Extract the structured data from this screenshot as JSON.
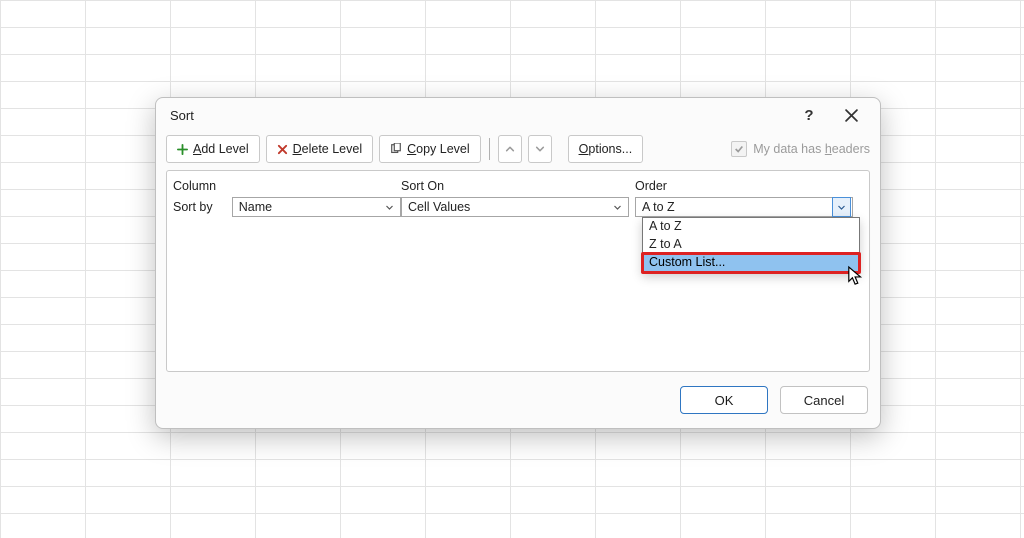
{
  "dialog": {
    "title": "Sort",
    "help_tooltip": "?",
    "toolbar": {
      "add_level": "Add Level",
      "delete_level": "Delete Level",
      "copy_level": "Copy Level",
      "options": "Options...",
      "headers_checkbox_label_prefix": "My data has ",
      "headers_checkbox_label_underlined": "h",
      "headers_checkbox_label_suffix": "eaders",
      "headers_checked": true,
      "headers_disabled": true
    },
    "columns": {
      "col_header": "Column",
      "sorton_header": "Sort On",
      "order_header": "Order"
    },
    "rows": [
      {
        "label": "Sort by",
        "column_value": "Name",
        "sorton_value": "Cell Values",
        "order_value": "A to Z"
      }
    ],
    "order_dropdown": {
      "open": true,
      "options": [
        {
          "label": "A to Z",
          "highlighted": false
        },
        {
          "label": "Z to A",
          "highlighted": false
        },
        {
          "label": "Custom List...",
          "highlighted": true,
          "boxed": true
        }
      ]
    },
    "footer": {
      "ok": "OK",
      "cancel": "Cancel"
    }
  }
}
